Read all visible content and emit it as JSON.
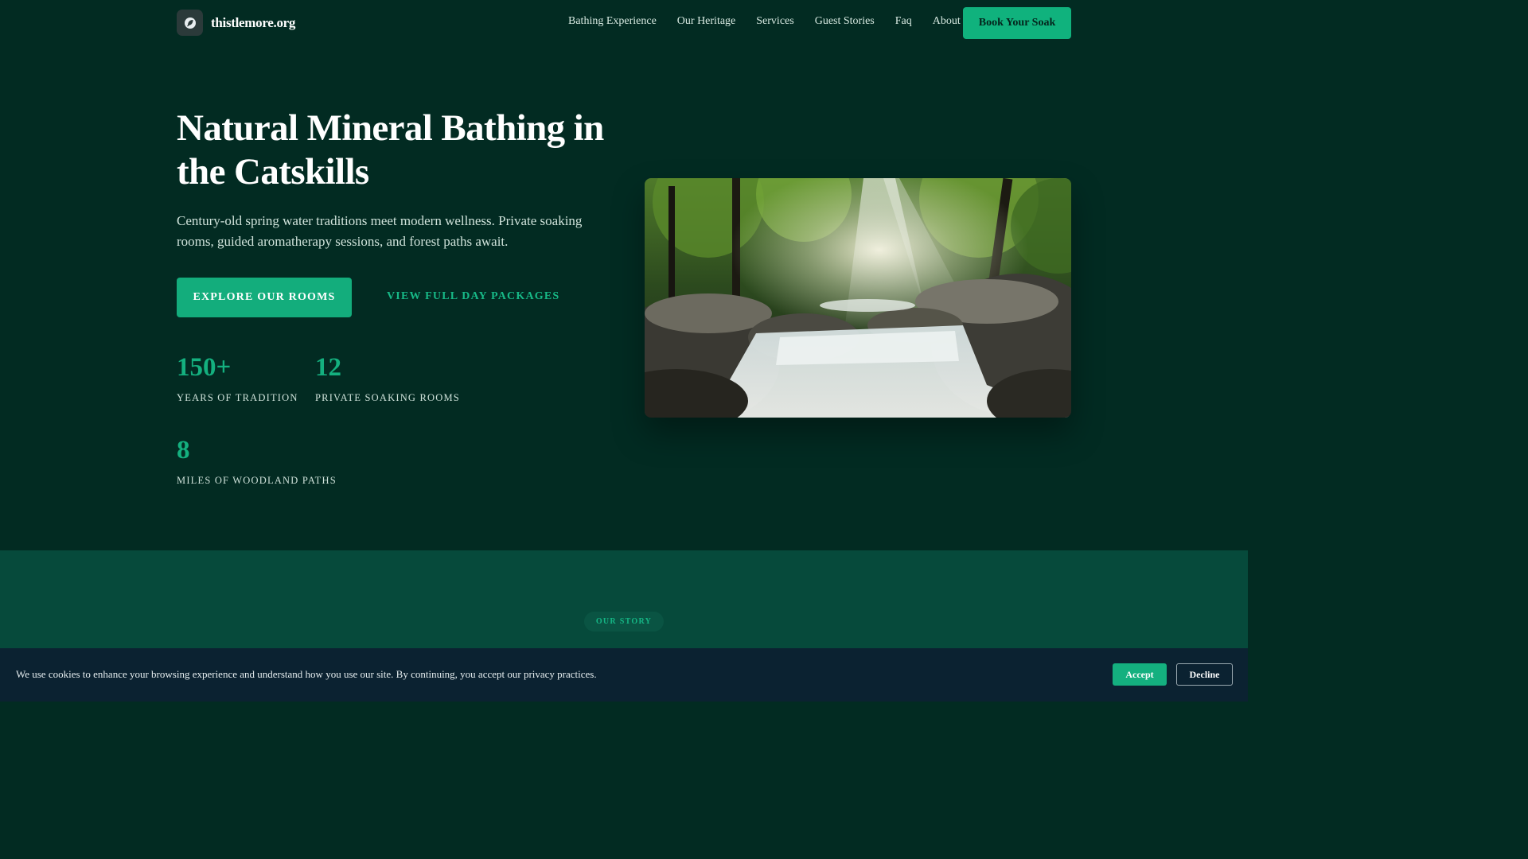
{
  "brand": {
    "name": "thistlemore.org",
    "icon": "leaf-logo-icon"
  },
  "nav": {
    "links": [
      "Bathing Experience",
      "Our Heritage",
      "Services",
      "Guest Stories",
      "Faq",
      "About"
    ],
    "cta": "Book Your Soak"
  },
  "hero": {
    "title": "Natural Mineral Bathing in the Catskills",
    "subtitle": "Century-old spring water traditions meet modern wellness. Private soaking rooms, guided aromatherapy sessions, and forest paths await.",
    "primary_button": "EXPLORE OUR ROOMS",
    "secondary_link": "VIEW FULL DAY PACKAGES",
    "stats": [
      {
        "value": "150+",
        "label": "YEARS OF TRADITION"
      },
      {
        "value": "12",
        "label": "PRIVATE SOAKING ROOMS"
      },
      {
        "value": "8",
        "label": "MILES OF WOODLAND PATHS"
      }
    ],
    "image": "forest-waterfall-photo"
  },
  "story": {
    "eyebrow": "OUR STORY"
  },
  "cookie": {
    "text": "We use cookies to enhance your browsing experience and understand how you use our site. By continuing, you accept our privacy practices.",
    "accept": "Accept",
    "decline": "Decline"
  },
  "colors": {
    "background": "#022b22",
    "accent": "#13ad7c",
    "section": "#064a3b",
    "banner": "#0b2231"
  }
}
